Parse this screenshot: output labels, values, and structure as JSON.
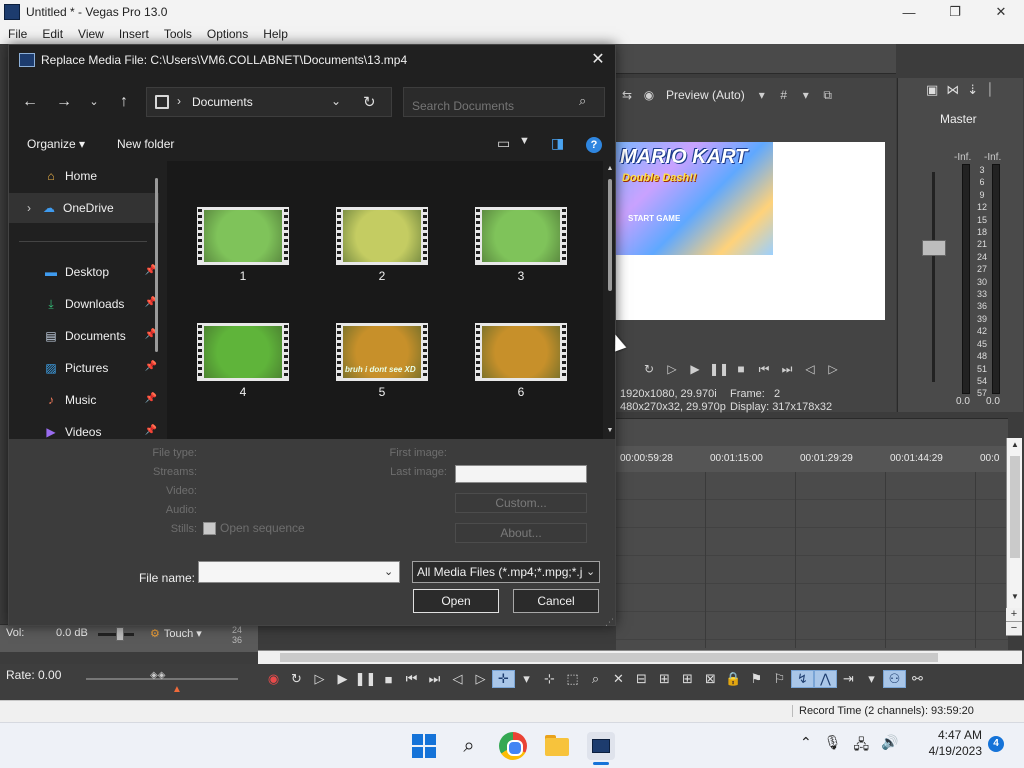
{
  "window": {
    "title": "Untitled * - Vegas Pro 13.0",
    "minimize": "—",
    "maximize": "❐",
    "close": "✕"
  },
  "menu": [
    "File",
    "Edit",
    "View",
    "Insert",
    "Tools",
    "Options",
    "Help"
  ],
  "preview": {
    "quality": "Preview (Auto)",
    "thumb_logo": "MARIO KART",
    "thumb_sub": "Double Dash!!",
    "thumb_menu": "START GAME",
    "info_line1": "1920x1080, 29.970i",
    "info_line2": "480x270x32, 29.970p",
    "frame_label": "Frame:",
    "frame_value": "2",
    "display_label": "Display:",
    "display_value": "317x178x32"
  },
  "master": {
    "label": "Master",
    "left_head": "-Inf.",
    "right_head": "-Inf.",
    "scale": [
      "3",
      "6",
      "9",
      "12",
      "15",
      "18",
      "21",
      "24",
      "27",
      "30",
      "33",
      "36",
      "39",
      "42",
      "45",
      "48",
      "51",
      "54",
      "57"
    ],
    "left_value": "0.0",
    "right_value": "0.0"
  },
  "timeline": {
    "ruler": [
      "00:00:59:28",
      "00:01:15:00",
      "00:01:29:29",
      "00:01:44:29",
      "00:0"
    ]
  },
  "track": {
    "vol_label": "Vol:",
    "vol_value": "0.0 dB",
    "touch": "Touch",
    "num1": "24",
    "num2": "36"
  },
  "rate": {
    "label": "Rate: 0.00"
  },
  "status": {
    "record_time": "Record Time (2 channels): 93:59:20"
  },
  "dialog": {
    "title": "Replace Media File: C:\\Users\\VM6.COLLABNET\\Documents\\13.mp4",
    "address": "Documents",
    "search_placeholder": "Search Documents",
    "organize": "Organize ▾",
    "new_folder": "New folder",
    "nav": [
      {
        "label": "Home",
        "icon": "home-icon"
      },
      {
        "label": "OneDrive",
        "icon": "cloud-icon"
      },
      {
        "label": "Desktop",
        "icon": "desktop-icon"
      },
      {
        "label": "Downloads",
        "icon": "download-icon"
      },
      {
        "label": "Documents",
        "icon": "document-icon"
      },
      {
        "label": "Pictures",
        "icon": "picture-icon"
      },
      {
        "label": "Music",
        "icon": "music-icon"
      },
      {
        "label": "Videos",
        "icon": "video-icon"
      }
    ],
    "files": [
      {
        "name": "1",
        "color": "#7fc35a"
      },
      {
        "name": "2",
        "color": "#c4cc62"
      },
      {
        "name": "3",
        "color": "#7fc35a"
      },
      {
        "name": "4",
        "color": "#5fb43a"
      },
      {
        "name": "5",
        "color": "#c7902a",
        "caption": "bruh i dont see XD"
      },
      {
        "name": "6",
        "color": "#c7902a"
      }
    ],
    "props": {
      "file_type": "File type:",
      "streams": "Streams:",
      "video": "Video:",
      "audio": "Audio:",
      "stills": "Stills:",
      "first_image": "First image:",
      "last_image": "Last image:",
      "open_sequence": "Open sequence",
      "custom": "Custom...",
      "about": "About..."
    },
    "file_name_label": "File name:",
    "file_name_value": "",
    "filter": "All Media Files (*.mp4;*.mpg;*.j",
    "open": "Open",
    "cancel": "Cancel"
  },
  "taskbar": {
    "time": "4:47 AM",
    "date": "4/19/2023",
    "notifications": "4"
  }
}
